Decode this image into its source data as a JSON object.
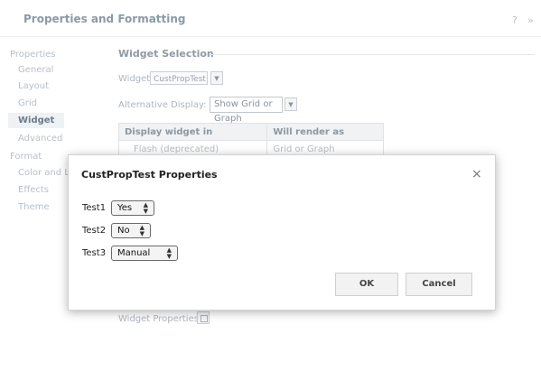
{
  "panel": {
    "title": "Properties and Formatting",
    "top_icons": [
      "?",
      "»"
    ],
    "nav": {
      "properties_header": "Properties",
      "properties_items": [
        "General",
        "Layout",
        "Grid",
        "Widget",
        "Advanced"
      ],
      "selected_item": "Widget",
      "format_header": "Format",
      "format_items": [
        "Color and Li",
        "Effects",
        "Theme"
      ]
    }
  },
  "widget_selection": {
    "heading": "Widget Selection",
    "widget_label": "Widget:",
    "widget_value": "CustPropTest",
    "alt_display_label": "Alternative Display:",
    "alt_display_value": "Show Grid or Graph",
    "table": {
      "headers": [
        "Display widget in",
        "Will render as"
      ],
      "rows": [
        [
          "Flash (deprecated)",
          "Grid or Graph"
        ]
      ]
    },
    "widget_properties_label": "Widget Properties:"
  },
  "dialog": {
    "title": "CustPropTest Properties",
    "close_glyph": "×",
    "fields": [
      {
        "label": "Test1",
        "value": "Yes"
      },
      {
        "label": "Test2",
        "value": "No"
      },
      {
        "label": "Test3",
        "value": "Manual"
      }
    ],
    "ok_label": "OK",
    "cancel_label": "Cancel"
  }
}
